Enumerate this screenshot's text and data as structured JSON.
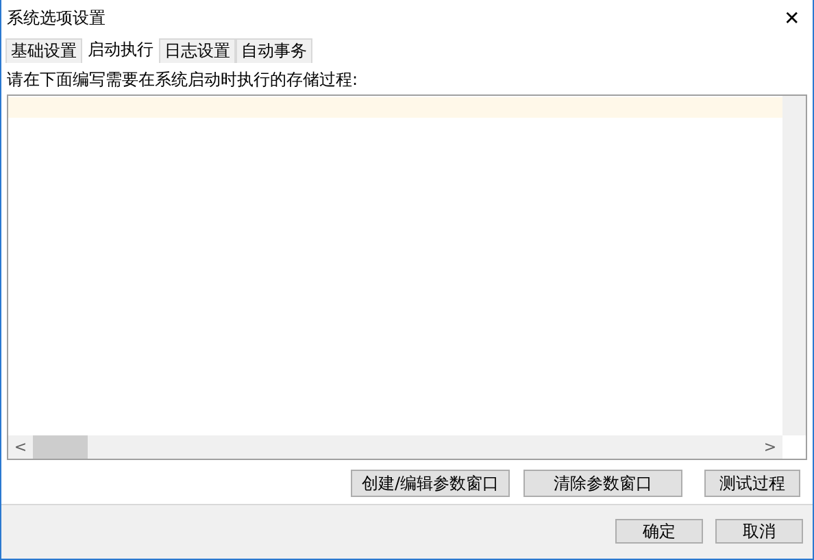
{
  "window": {
    "title": "系统选项设置",
    "close": "✕"
  },
  "tabs": [
    {
      "label": "基础设置",
      "selected": false
    },
    {
      "label": "启动执行",
      "selected": true
    },
    {
      "label": "日志设置",
      "selected": false
    },
    {
      "label": "自动事务",
      "selected": false
    }
  ],
  "prompt": "请在下面编写需要在系统启动时执行的存储过程:",
  "editor": {
    "left_arrow": "<",
    "right_arrow": ">"
  },
  "panel_buttons": [
    "创建/编辑参数窗口",
    "清除参数窗口",
    "测试过程"
  ],
  "buttons": [
    "确定",
    "取消"
  ]
}
